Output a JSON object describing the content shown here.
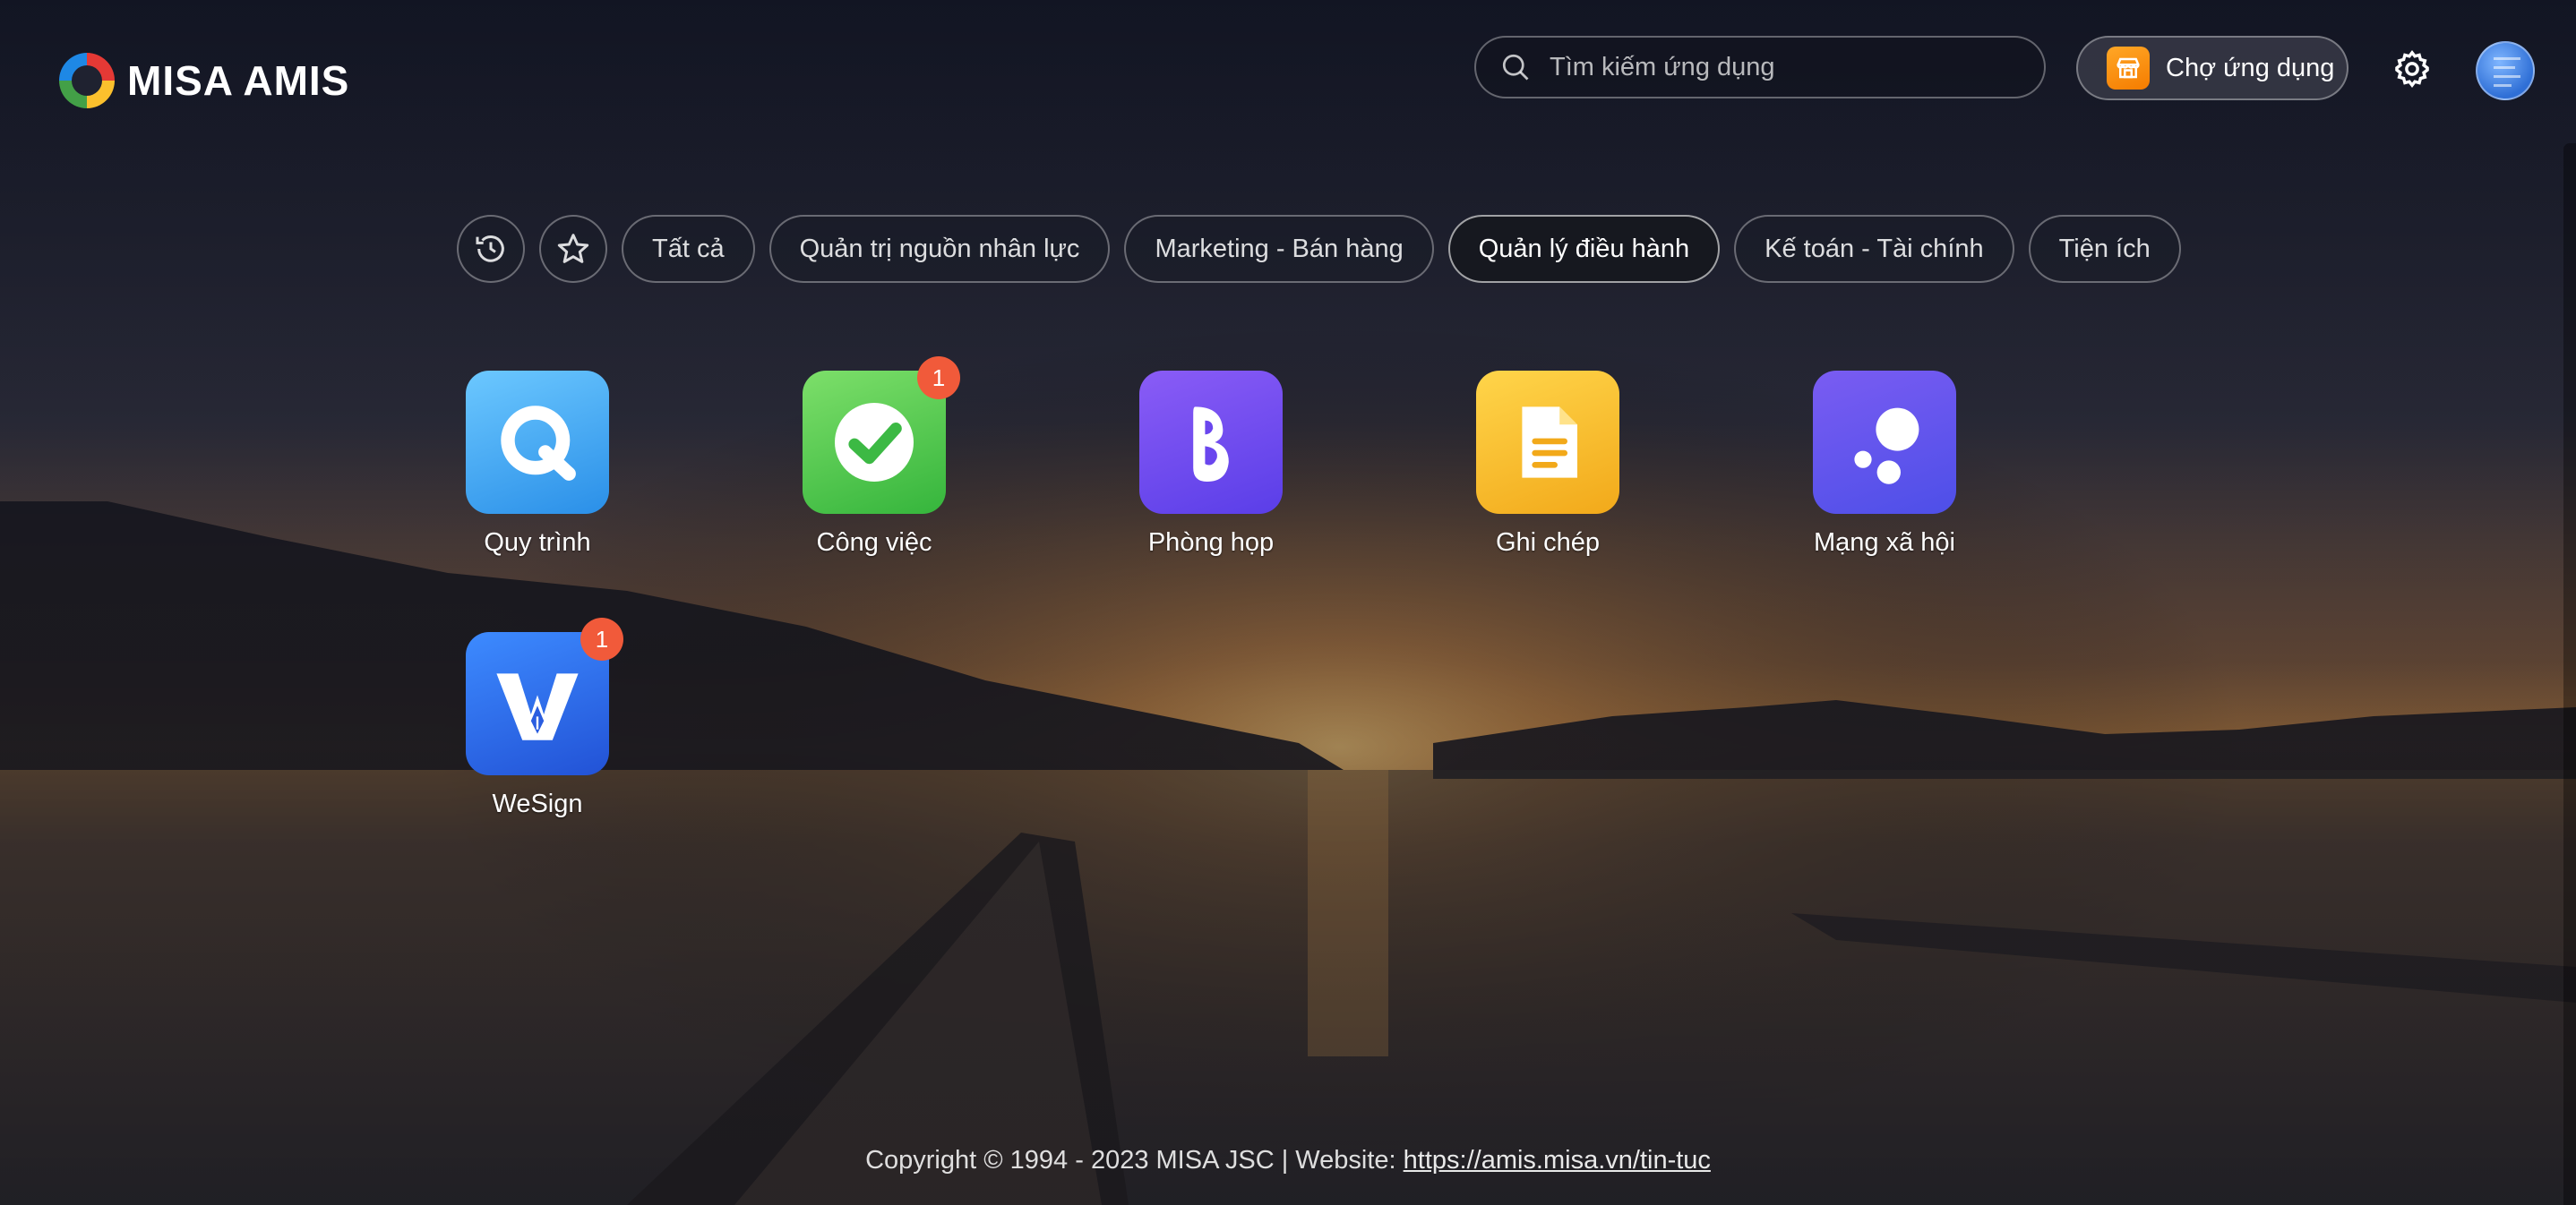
{
  "brand": {
    "name": "MISA AMIS"
  },
  "search": {
    "placeholder": "Tìm kiếm ứng dụng"
  },
  "market": {
    "label": "Chợ ứng dụng",
    "icon": "store-icon"
  },
  "tabs": [
    {
      "label": "Tất cả",
      "active": false
    },
    {
      "label": "Quản trị nguồn nhân lực",
      "active": false
    },
    {
      "label": "Marketing - Bán hàng",
      "active": false
    },
    {
      "label": "Quản lý điều hành",
      "active": true
    },
    {
      "label": "Kế toán - Tài chính",
      "active": false
    },
    {
      "label": "Tiện ích",
      "active": false
    }
  ],
  "apps": [
    {
      "label": "Quy trình",
      "icon": "quy-trinh-icon",
      "badge": null
    },
    {
      "label": "Công việc",
      "icon": "cong-viec-icon",
      "badge": "1"
    },
    {
      "label": "Phòng họp",
      "icon": "phong-hop-icon",
      "badge": null
    },
    {
      "label": "Ghi chép",
      "icon": "ghi-chep-icon",
      "badge": null
    },
    {
      "label": "Mạng xã hội",
      "icon": "mang-xa-hoi-icon",
      "badge": null
    },
    {
      "label": "WeSign",
      "icon": "wesign-icon",
      "badge": "1"
    }
  ],
  "footer": {
    "copyright": "Copyright © 1994 - 2023 MISA JSC | Website: ",
    "link": "https://amis.misa.vn/tin-tuc"
  },
  "colors": {
    "badge": "#f15a3a",
    "active_tab_bg": "#16181f"
  }
}
